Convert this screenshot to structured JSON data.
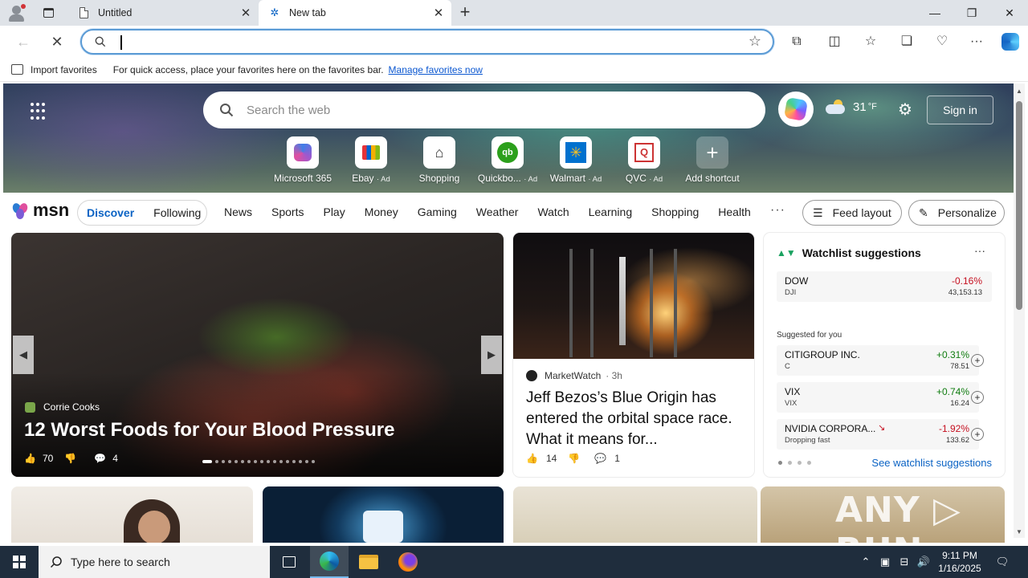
{
  "browser": {
    "tabs": [
      {
        "label": "Untitled"
      },
      {
        "label": "New tab"
      }
    ],
    "address": {
      "value": "",
      "placeholder": ""
    },
    "favorites_bar": {
      "import_label": "Import favorites",
      "message": "For quick access, place your favorites here on the favorites bar.",
      "link": "Manage favorites now"
    }
  },
  "hero": {
    "search_placeholder": "Search the web",
    "weather_temp": "31",
    "weather_unit": "°F",
    "signin_label": "Sign in",
    "shortcuts": [
      {
        "label": "Microsoft 365",
        "ad": ""
      },
      {
        "label": "Ebay",
        "ad": "· Ad"
      },
      {
        "label": "Shopping",
        "ad": ""
      },
      {
        "label": "Quickbo...",
        "ad": "· Ad"
      },
      {
        "label": "Walmart",
        "ad": "· Ad"
      },
      {
        "label": "QVC",
        "ad": "· Ad"
      },
      {
        "label": "Add shortcut",
        "ad": ""
      }
    ]
  },
  "msn": {
    "logo": "msn",
    "toggle": {
      "active": "Discover",
      "inactive": "Following"
    },
    "nav": [
      "News",
      "Sports",
      "Play",
      "Money",
      "Gaming",
      "Weather",
      "Watch",
      "Learning",
      "Shopping",
      "Health"
    ],
    "more": "···",
    "feed_layout_label": "Feed layout",
    "personalize_label": "Personalize"
  },
  "feature_card": {
    "source": "Corrie Cooks",
    "title": "12 Worst Foods for Your Blood Pressure",
    "likes": "70",
    "comments": "4"
  },
  "news_card": {
    "source": "MarketWatch",
    "age": "· 3h",
    "headline": "Jeff Bezos’s Blue Origin has entered the orbital space race. What it means for...",
    "likes": "14",
    "comments": "1"
  },
  "watchlist": {
    "title": "Watchlist suggestions",
    "more": "···",
    "suggested_label": "Suggested for you",
    "see_all": "See watchlist suggestions",
    "main": {
      "name": "DOW",
      "symbol": "DJI",
      "change": "-0.16%",
      "price": "43,153.13"
    },
    "items": [
      {
        "name": "CITIGROUP INC.",
        "symbol": "C",
        "change": "+0.31%",
        "price": "78.51"
      },
      {
        "name": "VIX",
        "symbol": "VIX",
        "change": "+0.74%",
        "price": "16.24"
      },
      {
        "name": "NVIDIA CORPORA...",
        "symbol": "Dropping fast",
        "change": "-1.92%",
        "price": "133.62"
      }
    ]
  },
  "watermark": "ANY ▷ RUN",
  "taskbar": {
    "search_placeholder": "Type here to search",
    "time": "9:11 PM",
    "date": "1/16/2025"
  },
  "colors": {
    "accent": "#0b63c4",
    "negative": "#c50f1f",
    "positive": "#107c10",
    "taskbar": "#1f2d3d"
  }
}
